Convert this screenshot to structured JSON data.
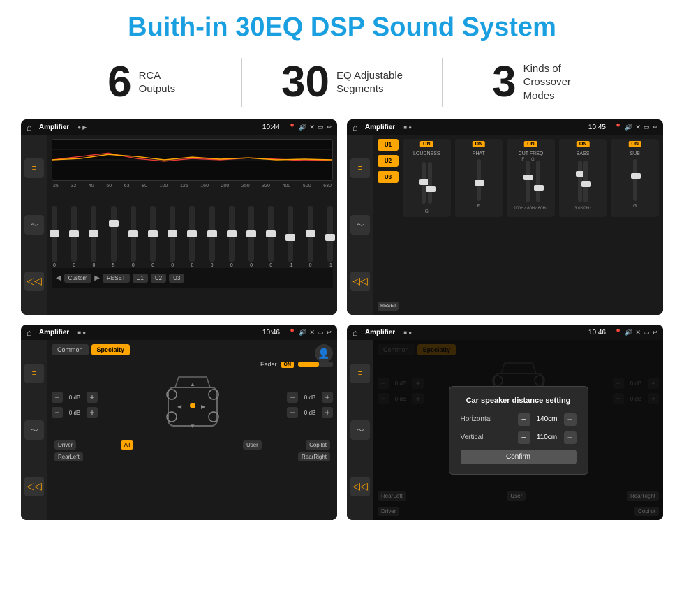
{
  "title": "Buith-in 30EQ DSP Sound System",
  "stats": [
    {
      "number": "6",
      "label": "RCA\nOutputs"
    },
    {
      "number": "30",
      "label": "EQ Adjustable\nSegments"
    },
    {
      "number": "3",
      "label": "Kinds of\nCrossover Modes"
    }
  ],
  "screens": [
    {
      "id": "screen1",
      "statusBar": {
        "title": "Amplifier",
        "time": "10:44"
      },
      "type": "eq-sliders",
      "freqs": [
        "25",
        "32",
        "40",
        "50",
        "63",
        "80",
        "100",
        "125",
        "160",
        "200",
        "250",
        "320",
        "400",
        "500",
        "630"
      ],
      "values": [
        "0",
        "0",
        "0",
        "5",
        "0",
        "0",
        "0",
        "0",
        "0",
        "0",
        "0",
        "0",
        "-1",
        "0",
        "-1"
      ],
      "bottomButtons": [
        "Custom",
        "RESET",
        "U1",
        "U2",
        "U3"
      ]
    },
    {
      "id": "screen2",
      "statusBar": {
        "title": "Amplifier",
        "time": "10:45"
      },
      "type": "amp-modules",
      "presets": [
        "U1",
        "U2",
        "U3"
      ],
      "modules": [
        {
          "name": "LOUDNESS",
          "on": true
        },
        {
          "name": "PHAT",
          "on": true
        },
        {
          "name": "CUT FREQ",
          "on": true
        },
        {
          "name": "BASS",
          "on": true
        },
        {
          "name": "SUB",
          "on": true
        }
      ]
    },
    {
      "id": "screen3",
      "statusBar": {
        "title": "Amplifier",
        "time": "10:46"
      },
      "type": "speaker-layout",
      "tabs": [
        "Common",
        "Specialty"
      ],
      "activeTab": "Specialty",
      "faderLabel": "Fader",
      "faderOn": true,
      "volumes": [
        "0 dB",
        "0 dB",
        "0 dB",
        "0 dB"
      ],
      "bottomButtons": [
        "Driver",
        "All",
        "User",
        "RearLeft",
        "Copilot",
        "RearRight"
      ]
    },
    {
      "id": "screen4",
      "statusBar": {
        "title": "Amplifier",
        "time": "10:46"
      },
      "type": "dialog",
      "dialog": {
        "title": "Car speaker distance setting",
        "horizontal": {
          "label": "Horizontal",
          "value": "140cm"
        },
        "vertical": {
          "label": "Vertical",
          "value": "110cm"
        },
        "confirmLabel": "Confirm"
      },
      "tabs": [
        "Common",
        "Specialty"
      ],
      "activeTab": "Specialty",
      "bottomButtons": [
        "Driver",
        "RearLeft",
        "User",
        "Copilot",
        "RearRight"
      ]
    }
  ],
  "icons": {
    "home": "⌂",
    "equalizer": "≡",
    "waveform": "〜",
    "volume": "◁",
    "speaker": "♪",
    "person": "👤",
    "back": "↩",
    "settings": "⚙",
    "play": "▶",
    "pause": "⏸",
    "location": "📍"
  }
}
